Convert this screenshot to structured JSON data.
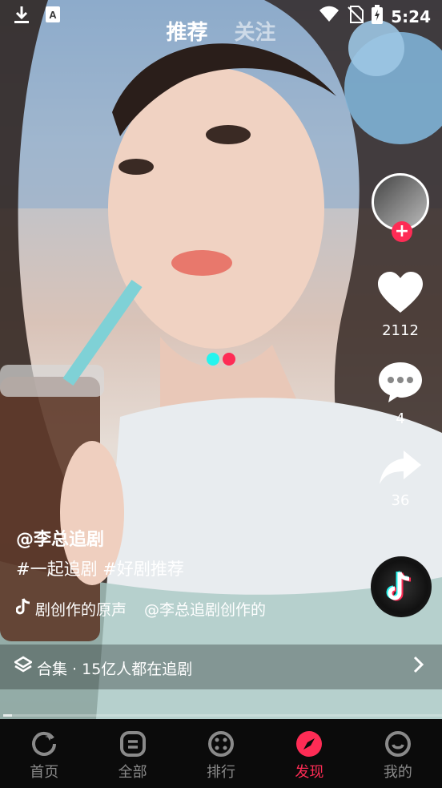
{
  "status_bar": {
    "time": "5:24"
  },
  "top_tabs": [
    {
      "label": "推荐",
      "active": true
    },
    {
      "label": "关注",
      "active": false
    }
  ],
  "side_actions": {
    "likes": "2112",
    "comments": "4",
    "shares": "36"
  },
  "post": {
    "author": "@李总追剧",
    "tags": "#一起追剧 #好剧推荐",
    "music": "剧创作的原声",
    "music_author": "@李总追剧创作的"
  },
  "collection": {
    "text": "合集 · 15亿人都在追剧"
  },
  "playback": {
    "progress": 0.02
  },
  "loader_colors": [
    "#25f4ee",
    "#fe2c55"
  ],
  "bottom_nav": [
    {
      "label": "首页",
      "icon": "home-icon",
      "active": false
    },
    {
      "label": "全部",
      "icon": "all-icon",
      "active": false
    },
    {
      "label": "排行",
      "icon": "ranking-icon",
      "active": false
    },
    {
      "label": "发现",
      "icon": "compass-icon",
      "active": true
    },
    {
      "label": "我的",
      "icon": "profile-icon",
      "active": false
    }
  ],
  "colors": {
    "accent": "#fe2c55",
    "cyan": "#25f4ee"
  }
}
